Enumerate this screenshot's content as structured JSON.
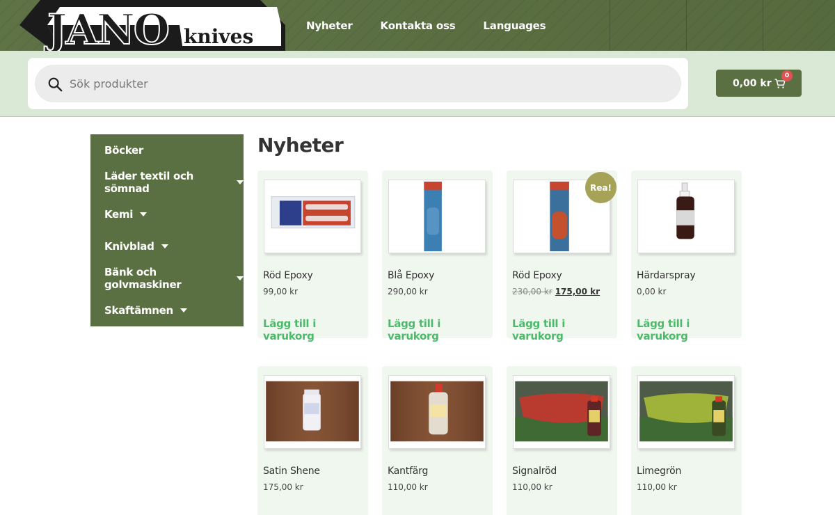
{
  "header": {
    "logo_main": "JANO",
    "logo_sub": "knives",
    "nav": [
      {
        "label": "Nyheter"
      },
      {
        "label": "Kontakta oss"
      },
      {
        "label": "Languages"
      }
    ]
  },
  "search": {
    "placeholder": "Sök produkter"
  },
  "cart": {
    "total": "0,00 kr",
    "count": "0"
  },
  "sidebar": {
    "items": [
      {
        "label": "Böcker"
      },
      {
        "label": "Läder textil och sömnad"
      },
      {
        "label": "Kemi"
      },
      {
        "label": "Knivblad"
      },
      {
        "label": "Bänk och golvmaskiner"
      },
      {
        "label": "Skaftämnen"
      }
    ]
  },
  "main": {
    "title": "Nyheter",
    "add_label": "Lägg till i varukorg",
    "sale_label": "Rea!",
    "products": [
      {
        "name": "Röd Epoxy",
        "price": "99,00 kr"
      },
      {
        "name": "Blå Epoxy",
        "price": "290,00 kr"
      },
      {
        "name": "Röd Epoxy",
        "old_price": "230,00 kr",
        "price": "175,00 kr"
      },
      {
        "name": "Härdarspray",
        "price": "0,00 kr"
      },
      {
        "name": "Satin Shene",
        "price": "175,00 kr"
      },
      {
        "name": "Kantfärg",
        "price": "110,00 kr"
      },
      {
        "name": "Signalröd",
        "price": "110,00 kr"
      },
      {
        "name": "Limegrön",
        "price": "110,00 kr"
      }
    ]
  },
  "colors": {
    "header_green": "#5b7042",
    "search_band": "#d9e9d5",
    "add_to_cart_green": "#4dba6b",
    "sale_badge": "#a6a359",
    "card_bg": "#f0f7ef"
  }
}
